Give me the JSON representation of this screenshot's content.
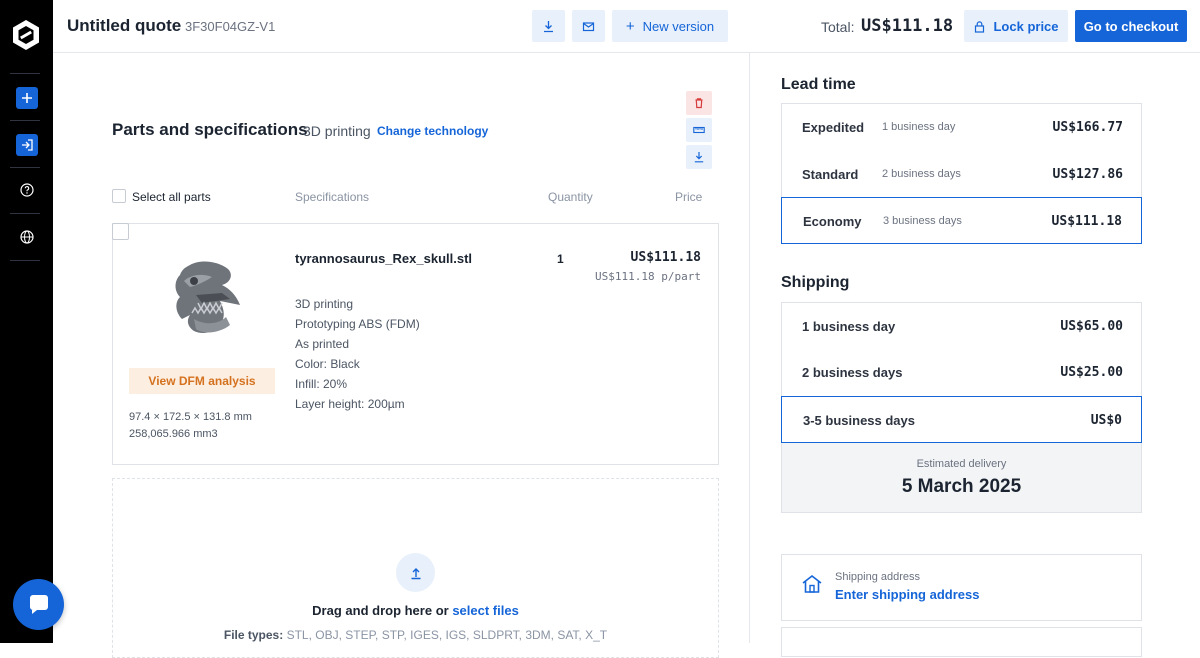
{
  "header": {
    "title": "Untitled quote",
    "quote_id": "3F30F04GZ-V1",
    "new_version_label": "New version",
    "total_label": "Total:",
    "total_value": "US$111.18",
    "lock_price_label": "Lock price",
    "checkout_label": "Go to checkout"
  },
  "parts": {
    "section_title": "Parts and specifications",
    "technology": "3D printing",
    "change_technology_label": "Change technology",
    "select_all_label": "Select all parts",
    "columns": [
      "Specifications",
      "Quantity",
      "Price"
    ],
    "items": [
      {
        "file_name": "tyrannosaurus_Rex_skull.stl",
        "dfm_label": "View DFM analysis",
        "dimensions": "97.4 × 172.5 × 131.8 mm",
        "volume": "258,065.966 mm3",
        "specs": [
          "3D printing",
          "Prototyping ABS (FDM)",
          "As printed",
          "Color: Black",
          "Infill: 20%",
          "Layer height: 200µm"
        ],
        "quantity": "1",
        "price": "US$111.18",
        "unit_price": "US$111.18 p/part"
      }
    ]
  },
  "dropzone": {
    "text": "Drag and drop here or ",
    "link": "select files",
    "file_types_label": "File types:",
    "file_types": "STL, OBJ, STEP, STP, IGES, IGS, SLDPRT, 3DM, SAT, X_T"
  },
  "lead_time": {
    "title": "Lead time",
    "options": [
      {
        "name": "Expedited",
        "days": "1 business day",
        "price": "US$166.77",
        "selected": false
      },
      {
        "name": "Standard",
        "days": "2 business days",
        "price": "US$127.86",
        "selected": false
      },
      {
        "name": "Economy",
        "days": "3 business days",
        "price": "US$111.18",
        "selected": true
      }
    ]
  },
  "shipping": {
    "title": "Shipping",
    "options": [
      {
        "name": "1 business day",
        "price": "US$65.00",
        "selected": false
      },
      {
        "name": "2 business days",
        "price": "US$25.00",
        "selected": false
      },
      {
        "name": "3-5 business days",
        "price": "US$0",
        "selected": true
      }
    ],
    "estimated_label": "Estimated delivery",
    "estimated_date": "5 March 2025",
    "address_label": "Shipping address",
    "address_link": "Enter shipping address"
  },
  "colors": {
    "accent": "#1565d8",
    "rail": "#000000",
    "dfm": "#d4721f"
  },
  "icons": [
    "logo-icon",
    "plus-icon",
    "login-icon",
    "help-icon",
    "globe-icon",
    "chat-icon",
    "download-icon",
    "mail-icon",
    "lock-icon",
    "trash-icon",
    "ruler-icon",
    "upload-icon",
    "home-icon"
  ]
}
